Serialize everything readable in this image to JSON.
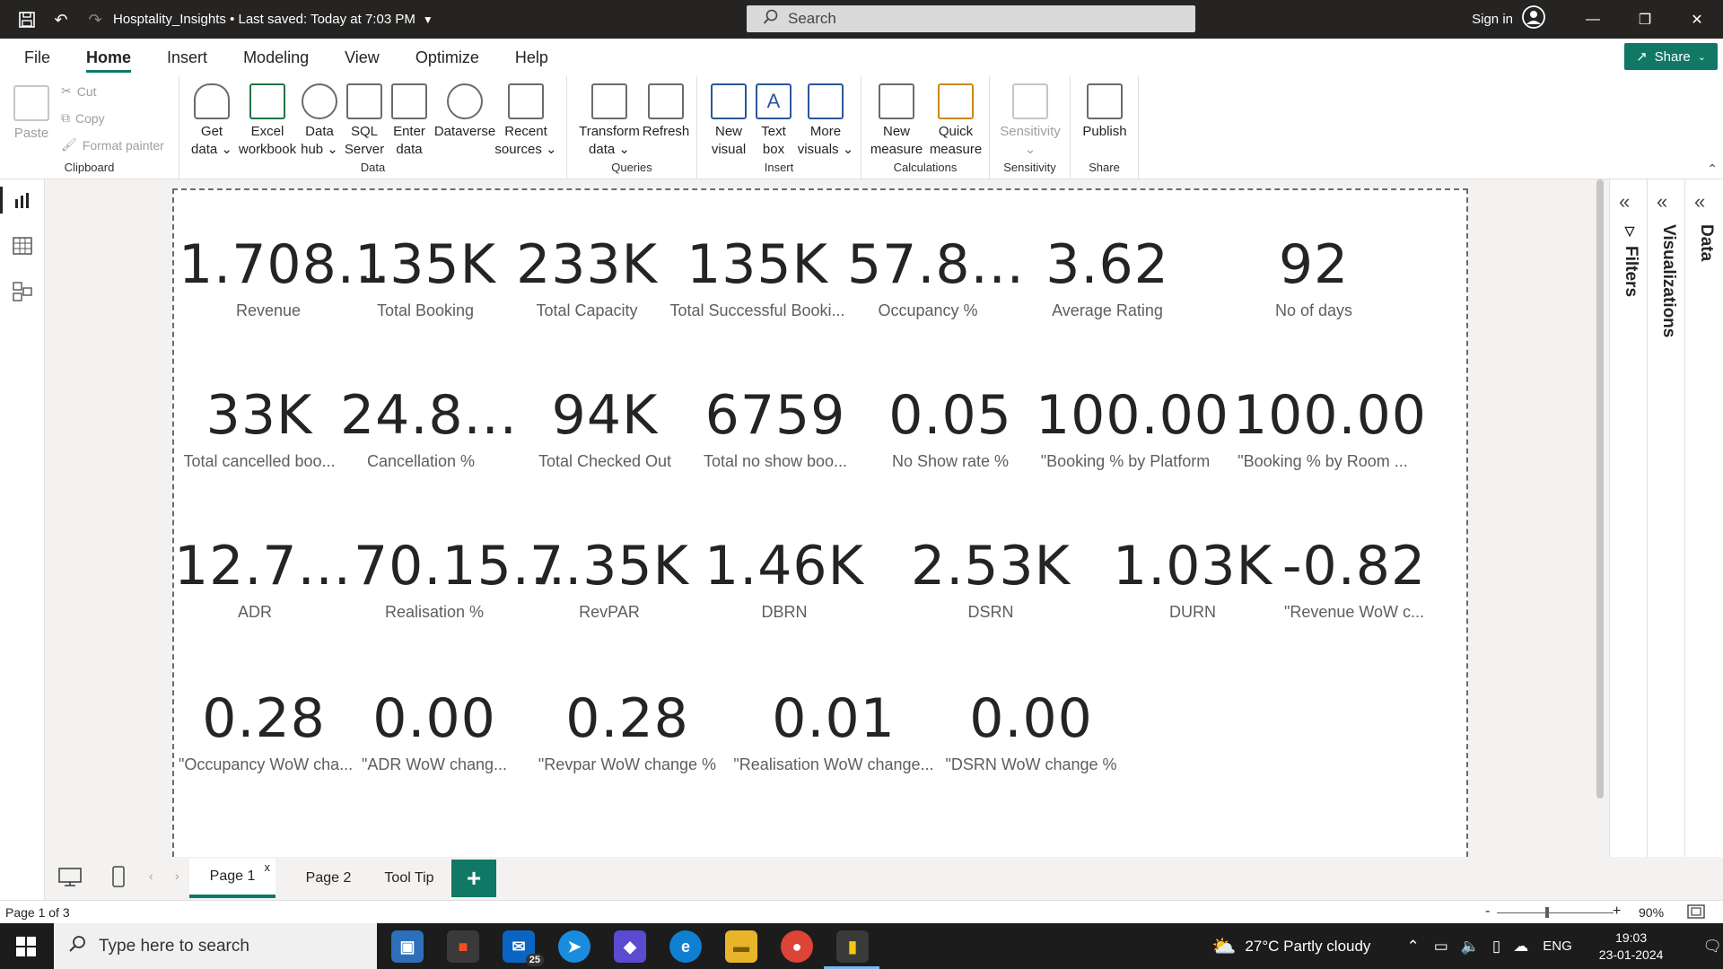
{
  "titlebar": {
    "title": "Hosptality_Insights • Last saved: Today at 7:03 PM",
    "search_placeholder": "Search",
    "sign_in": "Sign in",
    "minimize": "—",
    "maximize": "❐",
    "close": "✕"
  },
  "menu": {
    "tabs": [
      "File",
      "Home",
      "Insert",
      "Modeling",
      "View",
      "Optimize",
      "Help"
    ],
    "active": "Home",
    "share_label": "Share"
  },
  "ribbon": {
    "clipboard": {
      "paste": "Paste",
      "cut": "Cut",
      "copy": "Copy",
      "format_painter": "Format painter",
      "group": "Clipboard"
    },
    "data": {
      "group": "Data",
      "buttons": [
        {
          "l1": "Get",
          "l2": "data ⌄"
        },
        {
          "l1": "Excel",
          "l2": "workbook"
        },
        {
          "l1": "Data",
          "l2": "hub ⌄"
        },
        {
          "l1": "SQL",
          "l2": "Server"
        },
        {
          "l1": "Enter",
          "l2": "data"
        },
        {
          "l1": "Dataverse",
          "l2": ""
        },
        {
          "l1": "Recent",
          "l2": "sources ⌄"
        }
      ]
    },
    "queries": {
      "group": "Queries",
      "transform_l1": "Transform",
      "transform_l2": "data ⌄",
      "refresh": "Refresh"
    },
    "insert": {
      "group": "Insert",
      "new_visual_l1": "New",
      "new_visual_l2": "visual",
      "text_box_l1": "Text",
      "text_box_l2": "box",
      "more_visuals_l1": "More",
      "more_visuals_l2": "visuals ⌄"
    },
    "calculations": {
      "group": "Calculations",
      "new_measure_l1": "New",
      "new_measure_l2": "measure",
      "quick_measure_l1": "Quick",
      "quick_measure_l2": "measure"
    },
    "sensitivity": {
      "group": "Sensitivity",
      "label": "Sensitivity",
      "chev": "⌄"
    },
    "share": {
      "group": "Share",
      "publish": "Publish"
    }
  },
  "cards": [
    {
      "value": "1.708...",
      "label": "Revenue"
    },
    {
      "value": "135K",
      "label": "Total Booking"
    },
    {
      "value": "233K",
      "label": "Total Capacity"
    },
    {
      "value": "135K",
      "label": "Total Successful Booki..."
    },
    {
      "value": "57.8...",
      "label": "Occupancy %"
    },
    {
      "value": "3.62",
      "label": "Average Rating"
    },
    {
      "value": "92",
      "label": "No of days"
    },
    {
      "value": "33K",
      "label": "Total cancelled boo..."
    },
    {
      "value": "24.8...",
      "label": "Cancellation %"
    },
    {
      "value": "94K",
      "label": "Total Checked Out"
    },
    {
      "value": "6759",
      "label": "Total no show boo..."
    },
    {
      "value": "0.05",
      "label": "No Show rate %"
    },
    {
      "value": "100.00",
      "label": "\"Booking % by Platform"
    },
    {
      "value": "100.00",
      "label": "\"Booking % by Room ..."
    },
    {
      "value": "12.7...",
      "label": "ADR"
    },
    {
      "value": "70.15...",
      "label": "Realisation %"
    },
    {
      "value": "7.35K",
      "label": "RevPAR"
    },
    {
      "value": "1.46K",
      "label": "DBRN"
    },
    {
      "value": "2.53K",
      "label": "DSRN"
    },
    {
      "value": "1.03K",
      "label": "DURN"
    },
    {
      "value": "-0.82",
      "label": "\"Revenue WoW c..."
    },
    {
      "value": "0.28",
      "label": "\"Occupancy WoW cha..."
    },
    {
      "value": "0.00",
      "label": "\"ADR WoW chang..."
    },
    {
      "value": "0.28",
      "label": "\"Revpar WoW change %"
    },
    {
      "value": "0.01",
      "label": "\"Realisation WoW change..."
    },
    {
      "value": "0.00",
      "label": "\"DSRN WoW change %"
    }
  ],
  "panes": {
    "filters": "Filters",
    "visualizations": "Visualizations",
    "data": "Data"
  },
  "pages": {
    "page1": "Page 1",
    "page1_close": "x",
    "page2": "Page 2",
    "tooltip": "Tool Tip",
    "add": "+"
  },
  "status": {
    "page_info": "Page 1 of 3",
    "zoom_minus": "-",
    "zoom_plus": "+",
    "zoom": "90%"
  },
  "taskbar": {
    "search_placeholder": "Type here to search",
    "mail_badge": "25",
    "weather": "27°C  Partly cloudy",
    "lang": "ENG",
    "time": "19:03",
    "date": "23-01-2024"
  }
}
